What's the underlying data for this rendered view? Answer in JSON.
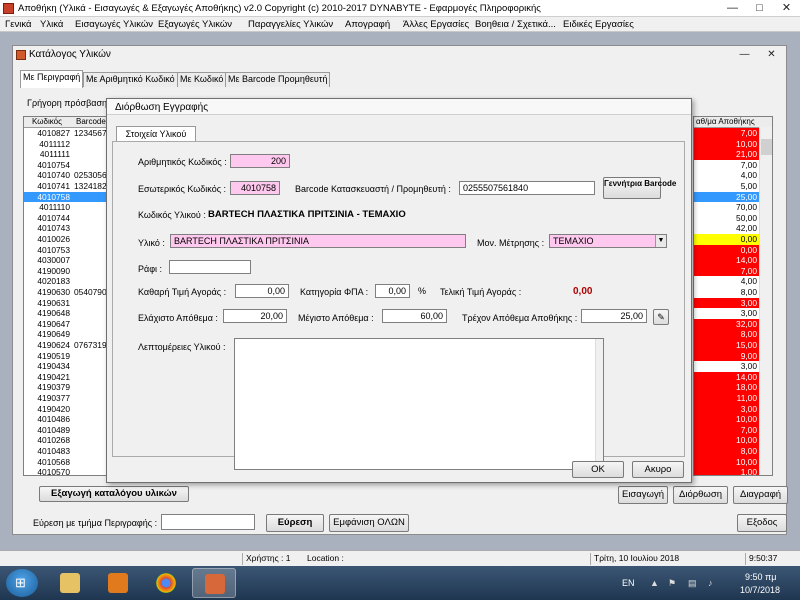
{
  "window": {
    "title": "Αποθήκη (Υλικά - Εισαγωγές & Εξαγωγές Αποθήκης)  v2.0   Copyright (c) 2010-2017  DYNABYTE - Εφαρμογές Πληροφορικής",
    "min": "—",
    "max": "□",
    "close": "✕"
  },
  "menu": [
    "Γενικά",
    "Υλικά",
    "Εισαγωγές Υλικών",
    "Εξαγωγές Υλικών",
    "Παραγγελίες Υλικών",
    "Απογραφή",
    "Άλλες Εργασίες",
    "Βοηθεια / Σχετικά...",
    "Ειδικές Εργασίες"
  ],
  "catalog": {
    "title": "Κατάλογος Υλικών",
    "tabs": [
      "Με Περιγραφή",
      "Με Αριθμητικό Κωδικό",
      "Με Κωδικό",
      "Με Barcode Προμηθευτή"
    ],
    "quick_access_label": "Γρήγορη πρόσβαση μ",
    "col_code": "Κωδικός",
    "col_barcode": "Barcode",
    "col_stock": "αθ/μα Αποθήκης",
    "codes": [
      "4010827",
      "4011112",
      "4011111",
      "4010754",
      "4010740",
      "4010741",
      "4010758",
      "4011110",
      "4010744",
      "4010743",
      "4010026",
      "4010753",
      "4030007",
      "4190090",
      "4020183",
      "4190630",
      "4190631",
      "4190648",
      "4190647",
      "4190649",
      "4190624",
      "4190519",
      "4190434",
      "4190421",
      "4190379",
      "4190377",
      "4190420",
      "4010486",
      "4010489",
      "4010268",
      "4010483",
      "4010568",
      "4010570"
    ],
    "barcodes": [
      "1234567",
      "",
      "",
      "",
      "0253056",
      "1324182",
      "",
      "",
      "",
      "",
      "",
      "",
      "",
      "",
      "",
      "0540790",
      "",
      "",
      "",
      "",
      "0767319",
      "",
      "",
      "",
      "",
      "",
      "",
      "",
      "",
      "",
      "",
      "",
      ""
    ],
    "stocks": [
      "7,00",
      "10,00",
      "21,00",
      "7,00",
      "4,00",
      "5,00",
      "25,00",
      "70,00",
      "50,00",
      "42,00",
      "0,00",
      "0,00",
      "14,00",
      "7,00",
      "4,00",
      "8,00",
      "3,00",
      "3,00",
      "32,00",
      "8,00",
      "15,00",
      "9,00",
      "3,00",
      "14,00",
      "18,00",
      "11,00",
      "3,00",
      "10,00",
      "7,00",
      "10,00",
      "8,00",
      "10,00",
      "1,00"
    ],
    "stock_colors": [
      "#ff0000",
      "#ff0000",
      "#ff0000",
      "#ffffff",
      "#ffffff",
      "#ffffff",
      "#3399ff",
      "#ffffff",
      "#ffffff",
      "#ffffff",
      "#ffff00",
      "#ff0000",
      "#ff0000",
      "#ff0000",
      "#ffffff",
      "#ffffff",
      "#ff0000",
      "#ffffff",
      "#ff0000",
      "#ff0000",
      "#ff0000",
      "#ff0000",
      "#ffffff",
      "#ff0000",
      "#ff0000",
      "#ff0000",
      "#ff0000",
      "#ff0000",
      "#ff0000",
      "#ff0000",
      "#ff0000",
      "#ff0000",
      "#ff0000"
    ],
    "selected_index": 6,
    "export_label": "Εξαγωγή καταλόγου υλικών",
    "add_label": "Εισαγωγή",
    "edit_label": "Διόρθωση",
    "delete_label": "Διαγραφή",
    "search_label": "Εύρεση με τμήμα Περιγραφής :",
    "search_value": "",
    "find_label": "Εύρεση",
    "show_all_label": "Εμφάνιση ΟΛΩΝ",
    "exit_label": "Εξοδος"
  },
  "dialog": {
    "title": "Διόρθωση Εγγραφής",
    "tab": "Στοιχεία Υλικού",
    "numeric_code_label": "Αριθμητικός Κωδικός :",
    "numeric_code": "200",
    "internal_code_label": "Εσωτερικός Κωδικός :",
    "internal_code": "4010758",
    "barcode_label": "Barcode Κατασκευαστή / Προμηθευτή :",
    "barcode": "0255507561840",
    "generate_barcode_label": "Γεννήτρια Barcode",
    "item_code_label": "Κωδικός Υλικού :",
    "item_code_value": "BARTECH ΠΛΑΣΤΙΚΑ ΠΡΙΤΣΙΝΙΑ - ΤΕΜΑΧΙΟ",
    "material_label": "Υλικό :",
    "material": "BARTECH ΠΛΑΣΤΙΚΑ ΠΡΙΤΣΙΝΙΑ",
    "unit_label": "Μον. Μέτρησης :",
    "unit": "ΤΕΜΑΧΙΟ",
    "shelf_label": "Ράφι :",
    "shelf": "",
    "net_price_label": "Καθαρή Τιμή Αγοράς :",
    "net_price": "0,00",
    "vat_label": "Κατηγορία ΦΠΑ :",
    "vat": "0,00",
    "vat_unit": "%",
    "final_price_label": "Τελική Τιμή Αγοράς :",
    "final_price": "0,00",
    "min_stock_label": "Ελάχιστο Απόθεμα :",
    "min_stock": "20,00",
    "max_stock_label": "Μέγιστο Απόθεμα :",
    "max_stock": "60,00",
    "current_stock_label": "Τρέχον Απόθεμα Αποθήκης :",
    "current_stock": "25,00",
    "details_label": "Λεπτομέρειες Υλικού :",
    "details": "",
    "ok_label": "OK",
    "cancel_label": "Ακυρο"
  },
  "status": {
    "user": "Χρήστης : 1",
    "location": "Location :",
    "date": "Τρίτη, 10 Ιουλίου 2018",
    "time": "9:50:37"
  },
  "taskbar": {
    "lang": "EN",
    "clock_time": "9:50 πμ",
    "clock_date": "10/7/2018"
  },
  "colors": {
    "pink_field": "#ffc8ee",
    "selected_row": "#3399ff",
    "final_price": "#b00000"
  }
}
